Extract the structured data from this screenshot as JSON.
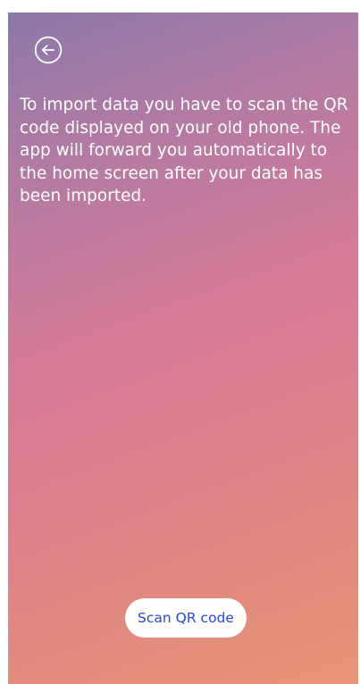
{
  "screen": {
    "back_button_label": "Back",
    "instruction_text": "To import data you have to scan the QR code displayed on your old phone. The app will forward you automatically to the home screen after your data has been imported.",
    "scan_button_label": "Scan QR code"
  },
  "icons": {
    "back": "arrow-left-circle-icon"
  },
  "colors": {
    "text": "#ffffff",
    "button_background": "#ffffff",
    "button_text": "#2b48d2"
  }
}
